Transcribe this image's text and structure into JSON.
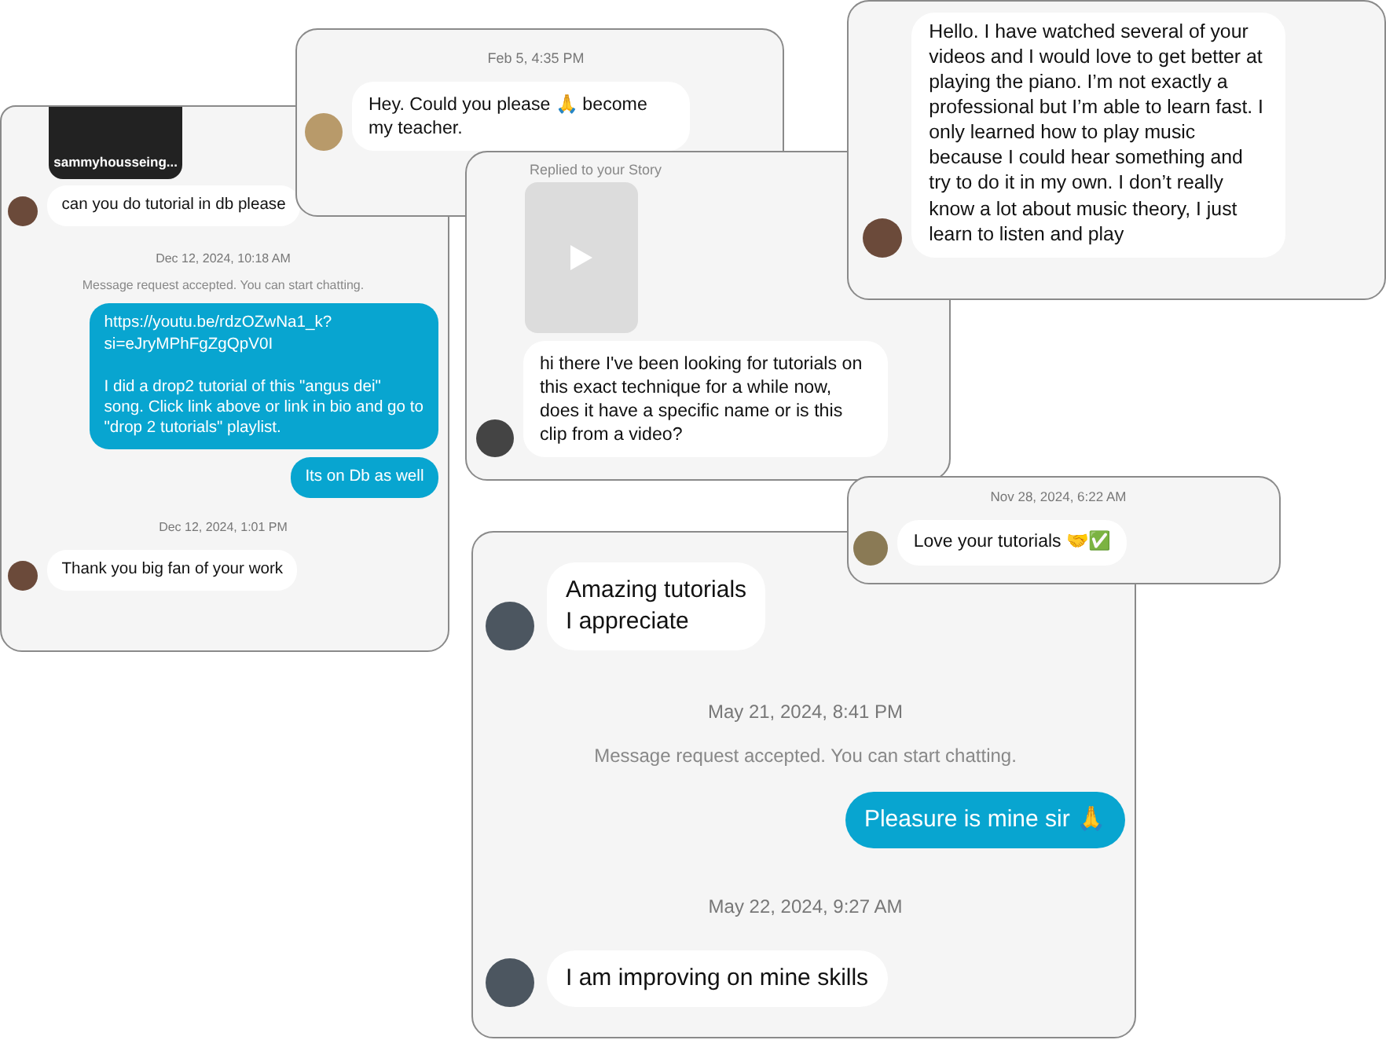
{
  "cards": [
    {
      "items": [
        {
          "kind": "video",
          "caption": "sammyhousseing..."
        },
        {
          "kind": "in",
          "text": "can you do tutorial in db please"
        },
        {
          "kind": "time",
          "text": "Dec 12, 2024, 10:18 AM"
        },
        {
          "kind": "notice",
          "text": "Message request accepted. You can start chatting."
        },
        {
          "kind": "out",
          "text": "https://youtu.be/rdzOZwNa1_k?si=eJryMPhFgZgQpV0I\n\nI did a drop2 tutorial of this \"angus dei\" song. Click link above or link in bio and go to \"drop 2 tutorials\" playlist."
        },
        {
          "kind": "out",
          "text": "Its on Db as well"
        },
        {
          "kind": "time",
          "text": "Dec 12, 2024, 1:01 PM"
        },
        {
          "kind": "in",
          "text": "Thank you big fan of your work"
        }
      ]
    },
    {
      "items": [
        {
          "kind": "time",
          "text": "Feb 5, 4:35 PM"
        },
        {
          "kind": "in",
          "text": "Hey. Could you please 🙏 become my teacher."
        }
      ]
    },
    {
      "items": [
        {
          "kind": "story-label",
          "text": "Replied to your Story"
        },
        {
          "kind": "story"
        },
        {
          "kind": "in",
          "text": "hi there I've been looking for tutorials on this exact technique for a while now, does it have a specific name or is this clip from a video?"
        }
      ]
    },
    {
      "items": [
        {
          "kind": "in",
          "text": "Hello. I have watched several of your videos and I would love to get better at playing the piano. I’m not exactly a professional but I’m able to learn fast. I only learned how to play music because I could hear something and try to do it in my own. I don’t really know a lot about music theory, I just learn to listen and play"
        }
      ]
    },
    {
      "items": [
        {
          "kind": "time",
          "text": "Nov 28, 2024, 6:22 AM"
        },
        {
          "kind": "in",
          "text": "Love your tutorials 🤝✅"
        }
      ]
    },
    {
      "items": [
        {
          "kind": "in",
          "text": "Amazing tutorials\nI appreciate"
        },
        {
          "kind": "time",
          "text": "May 21, 2024, 8:41 PM"
        },
        {
          "kind": "notice",
          "text": "Message request accepted. You can start chatting."
        },
        {
          "kind": "out",
          "text": "Pleasure is mine sir 🙏"
        },
        {
          "kind": "time",
          "text": "May 22, 2024, 9:27 AM"
        },
        {
          "kind": "in",
          "text": "I am improving on mine skills"
        }
      ]
    }
  ]
}
